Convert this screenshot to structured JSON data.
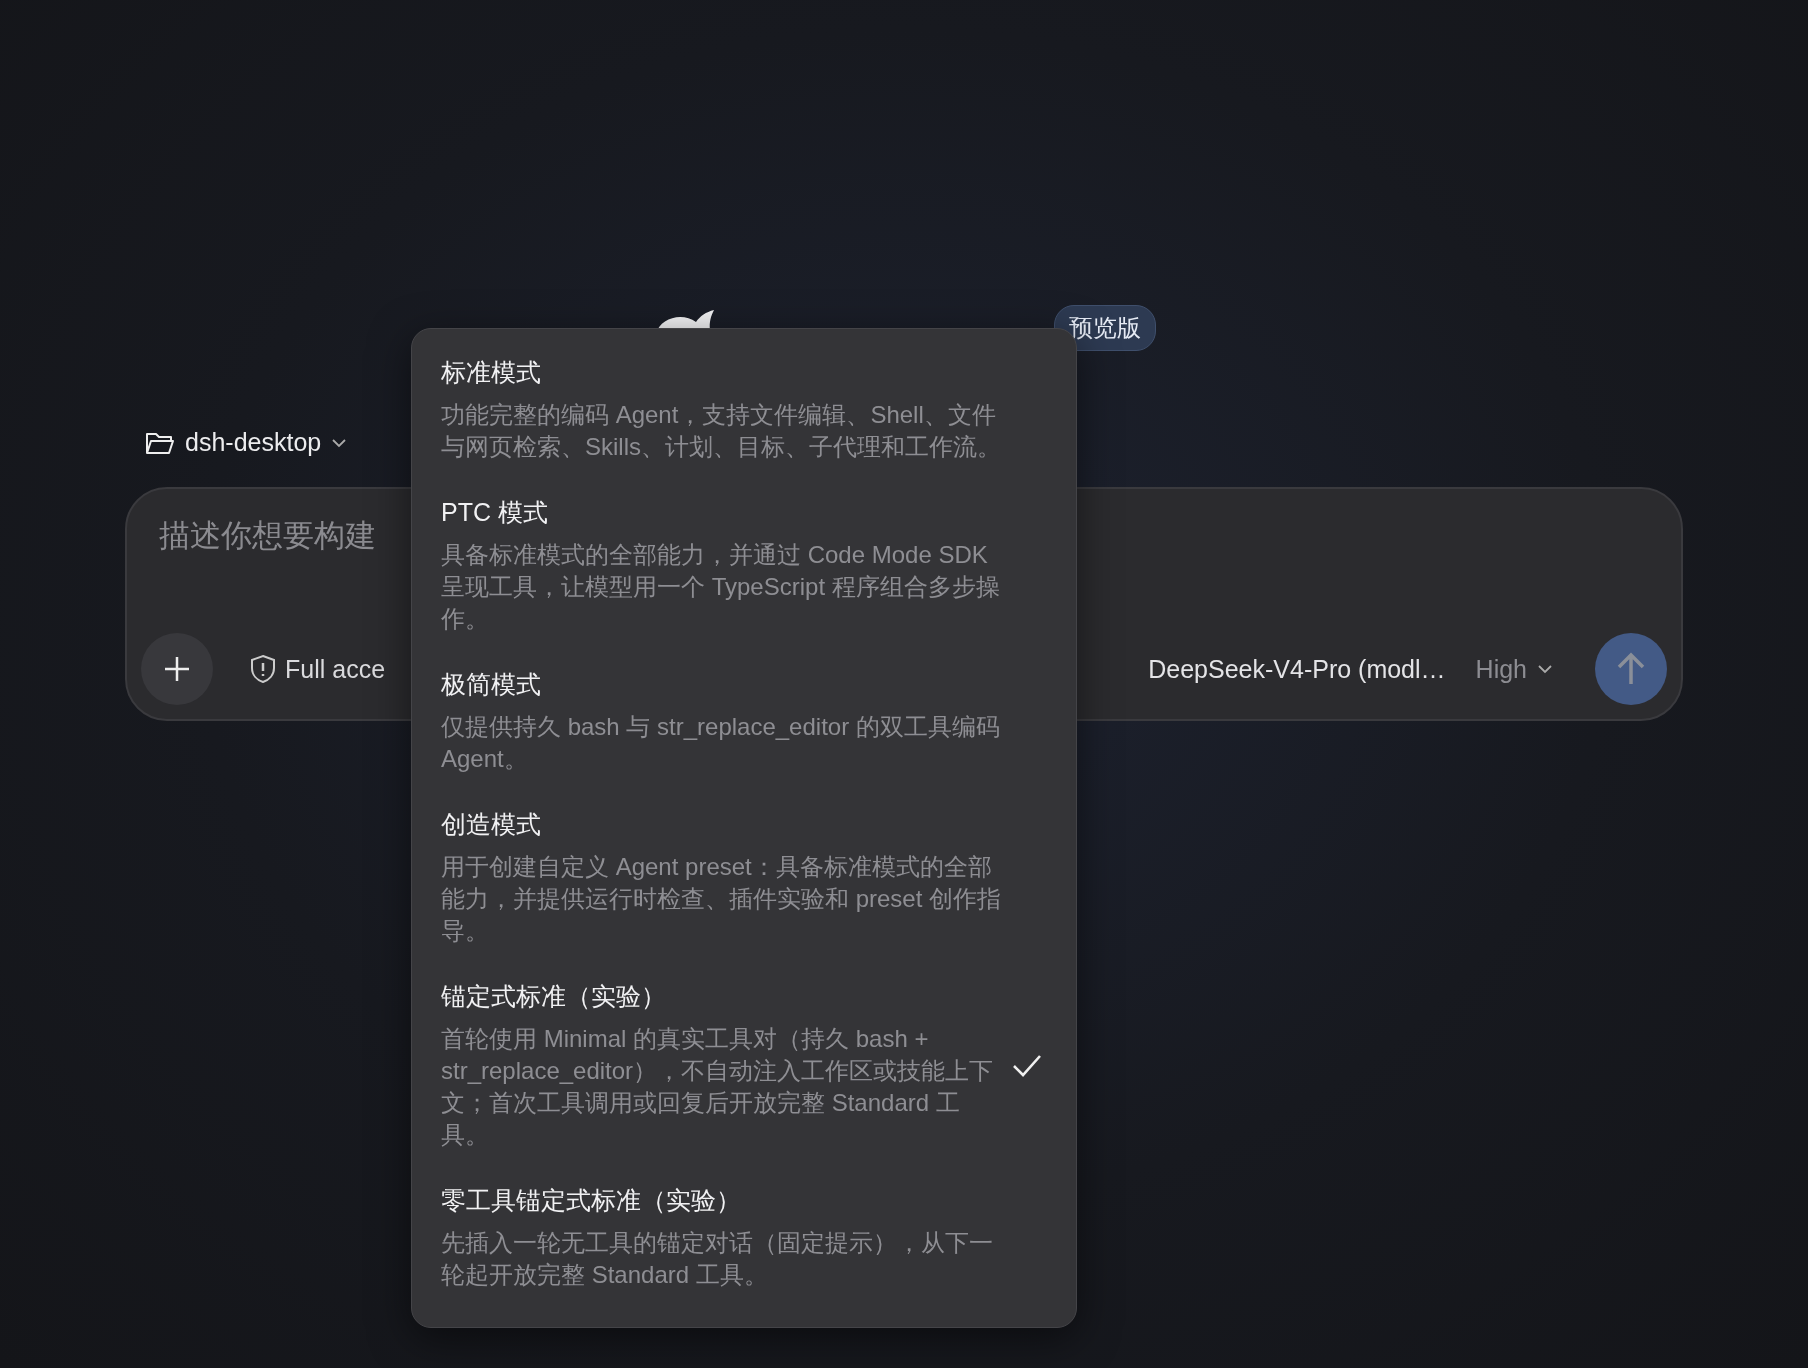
{
  "header": {
    "badge": "预览版"
  },
  "workspace": {
    "folder": "dsh-desktop"
  },
  "composer": {
    "placeholder": "描述你想要构建",
    "access": "Full acce",
    "model": "DeepSeek-V4-Pro (modl…",
    "effort": "High"
  },
  "mode_menu": {
    "items": [
      {
        "title": "标准模式",
        "description": "功能完整的编码 Agent，支持文件编辑、Shell、文件与网页检索、Skills、计划、目标、子代理和工作流。",
        "selected": false
      },
      {
        "title": "PTC 模式",
        "description": "具备标准模式的全部能力，并通过 Code Mode SDK 呈现工具，让模型用一个 TypeScript 程序组合多步操作。",
        "selected": false
      },
      {
        "title": "极简模式",
        "description": "仅提供持久 bash 与 str_replace_editor 的双工具编码 Agent。",
        "selected": false
      },
      {
        "title": "创造模式",
        "description": "用于创建自定义 Agent preset：具备标准模式的全部能力，并提供运行时检查、插件实验和 preset 创作指导。",
        "selected": false
      },
      {
        "title": "锚定式标准（实验）",
        "description": "首轮使用 Minimal 的真实工具对（持久 bash + str_replace_editor），不自动注入工作区或技能上下文；首次工具调用或回复后开放完整 Standard 工具。",
        "selected": true
      },
      {
        "title": "零工具锚定式标准（实验）",
        "description": "先插入一轮无工具的锚定对话（固定提示），从下一轮起开放完整 Standard 工具。",
        "selected": false
      }
    ]
  }
}
